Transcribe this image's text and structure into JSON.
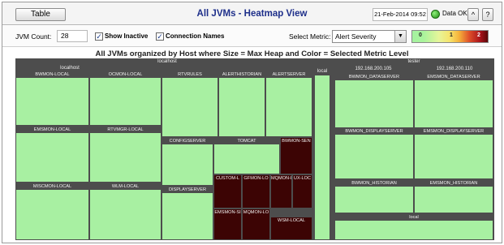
{
  "header": {
    "table_button": "Table",
    "title": "All JVMs - Heatmap View",
    "date": "21-Feb-2014 09:52",
    "status": "Data OK",
    "up_button": "^",
    "help_button": "?"
  },
  "controls": {
    "jvm_count_label": "JVM Count:",
    "jvm_count_value": "28",
    "show_inactive_label": "Show Inactive",
    "show_inactive_checked": true,
    "connection_names_label": "Connection Names",
    "connection_names_checked": true,
    "select_metric_label": "Select Metric:",
    "select_metric_value": "Alert Severity",
    "legend": {
      "min": "0",
      "mid": "1",
      "max": "2"
    }
  },
  "heatmap": {
    "title": "All JVMs organized by Host where Size = Max Heap and Color = Selected Metric Level",
    "colors": {
      "ok": "#a8f0a2",
      "critical": "#3c0404",
      "frame": "#4d4d4d"
    },
    "hosts": {
      "localhost": {
        "label": "localhost",
        "sub_label": "localhost",
        "cells": {
          "bwmon_local": "BWMON-LOCAL",
          "ocmon_local": "OCMON-LOCAL",
          "rtvrules": "RTVRULES",
          "alerthistorian": "ALERTHISTORIAN",
          "alertserver": "ALERTSERVER",
          "emsmon_local": "EMSMON-LOCAL",
          "rtvmgr_local": "RTVMGR-LOCAL",
          "configserver": "CONFIGSERVER",
          "tomcat": "TOMCAT",
          "bwmon_sen": "BWMON-SEN",
          "misc_mon_local": "MISCMON-LOCAL",
          "wlm_local": "WLM-LOCAL",
          "displayserver": "DISPLAYSERVER",
          "custom_l": "CUSTOM-L",
          "gfmon_lo": "GFMON-LO",
          "mqmon_lo": "MQMON-LO",
          "ux_lo": "UX-LOC",
          "emsmon_si": "EMSMON-SI",
          "mqmon_lo2": "MQMON-LO",
          "wsm_local": "WSM-LOCAL"
        }
      },
      "local": {
        "label": "local"
      },
      "tester": {
        "label": "tester",
        "ip1": "192.168.200.105",
        "ip2": "192.168.200.110",
        "cells": {
          "bwmon_dataserver": "BWMON_DATASERVER",
          "emsmon_dataserver": "EMSMON_DATASERVER",
          "bwmon_displayserver": "BWMON_DISPLAYSERVER",
          "emsmon_displayserver": "EMSMON_DISPLAYSERVER",
          "bwmon_historian": "BWMON_HISTORIAN",
          "emsmon_historian": "EMSMON_HISTORIAN",
          "local": "local"
        }
      }
    }
  }
}
